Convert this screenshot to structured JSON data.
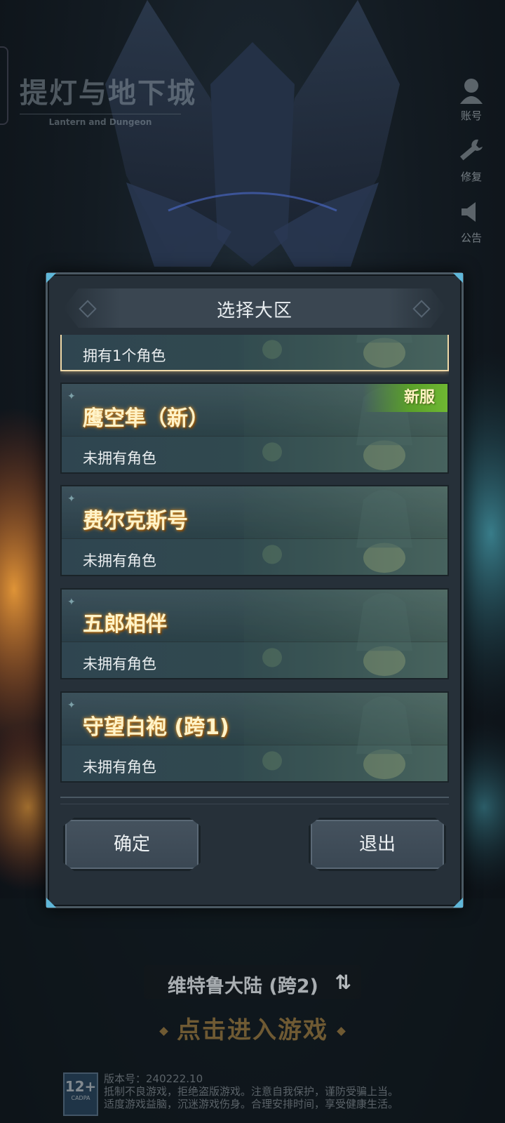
{
  "game": {
    "logo_cn": "提灯与地下城",
    "logo_en": "Lantern and Dungeon"
  },
  "right_menu": [
    {
      "label": "账号",
      "icon": "account-icon"
    },
    {
      "label": "修复",
      "icon": "wrench-icon"
    },
    {
      "label": "公告",
      "icon": "speaker-icon"
    }
  ],
  "dialog": {
    "title": "选择大区",
    "servers": [
      {
        "name": "",
        "status": "拥有1个角色",
        "selected": true,
        "new": false
      },
      {
        "name": "鹰空隼（新）",
        "status": "未拥有角色",
        "selected": false,
        "new": true
      },
      {
        "name": "费尔克斯号",
        "status": "未拥有角色",
        "selected": false,
        "new": false
      },
      {
        "name": "五郎相伴",
        "status": "未拥有角色",
        "selected": false,
        "new": false
      },
      {
        "name": "守望白袍 (跨1)",
        "status": "未拥有角色",
        "selected": false,
        "new": false
      }
    ],
    "new_badge": "新服",
    "confirm_label": "确定",
    "exit_label": "退出"
  },
  "current_server": {
    "name": "维特鲁大陆 (跨2)",
    "swap_glyph": "⇅"
  },
  "enter_game": "点击进入游戏",
  "footer": {
    "age_rating": "12+",
    "age_text": "CADPA",
    "version": "版本号：240222.10",
    "notice_1": "抵制不良游戏，拒绝盗版游戏。注意自我保护，谨防受骗上当。",
    "notice_2": "适度游戏益脑，沉迷游戏伤身。合理安排时间，享受健康生活。"
  }
}
